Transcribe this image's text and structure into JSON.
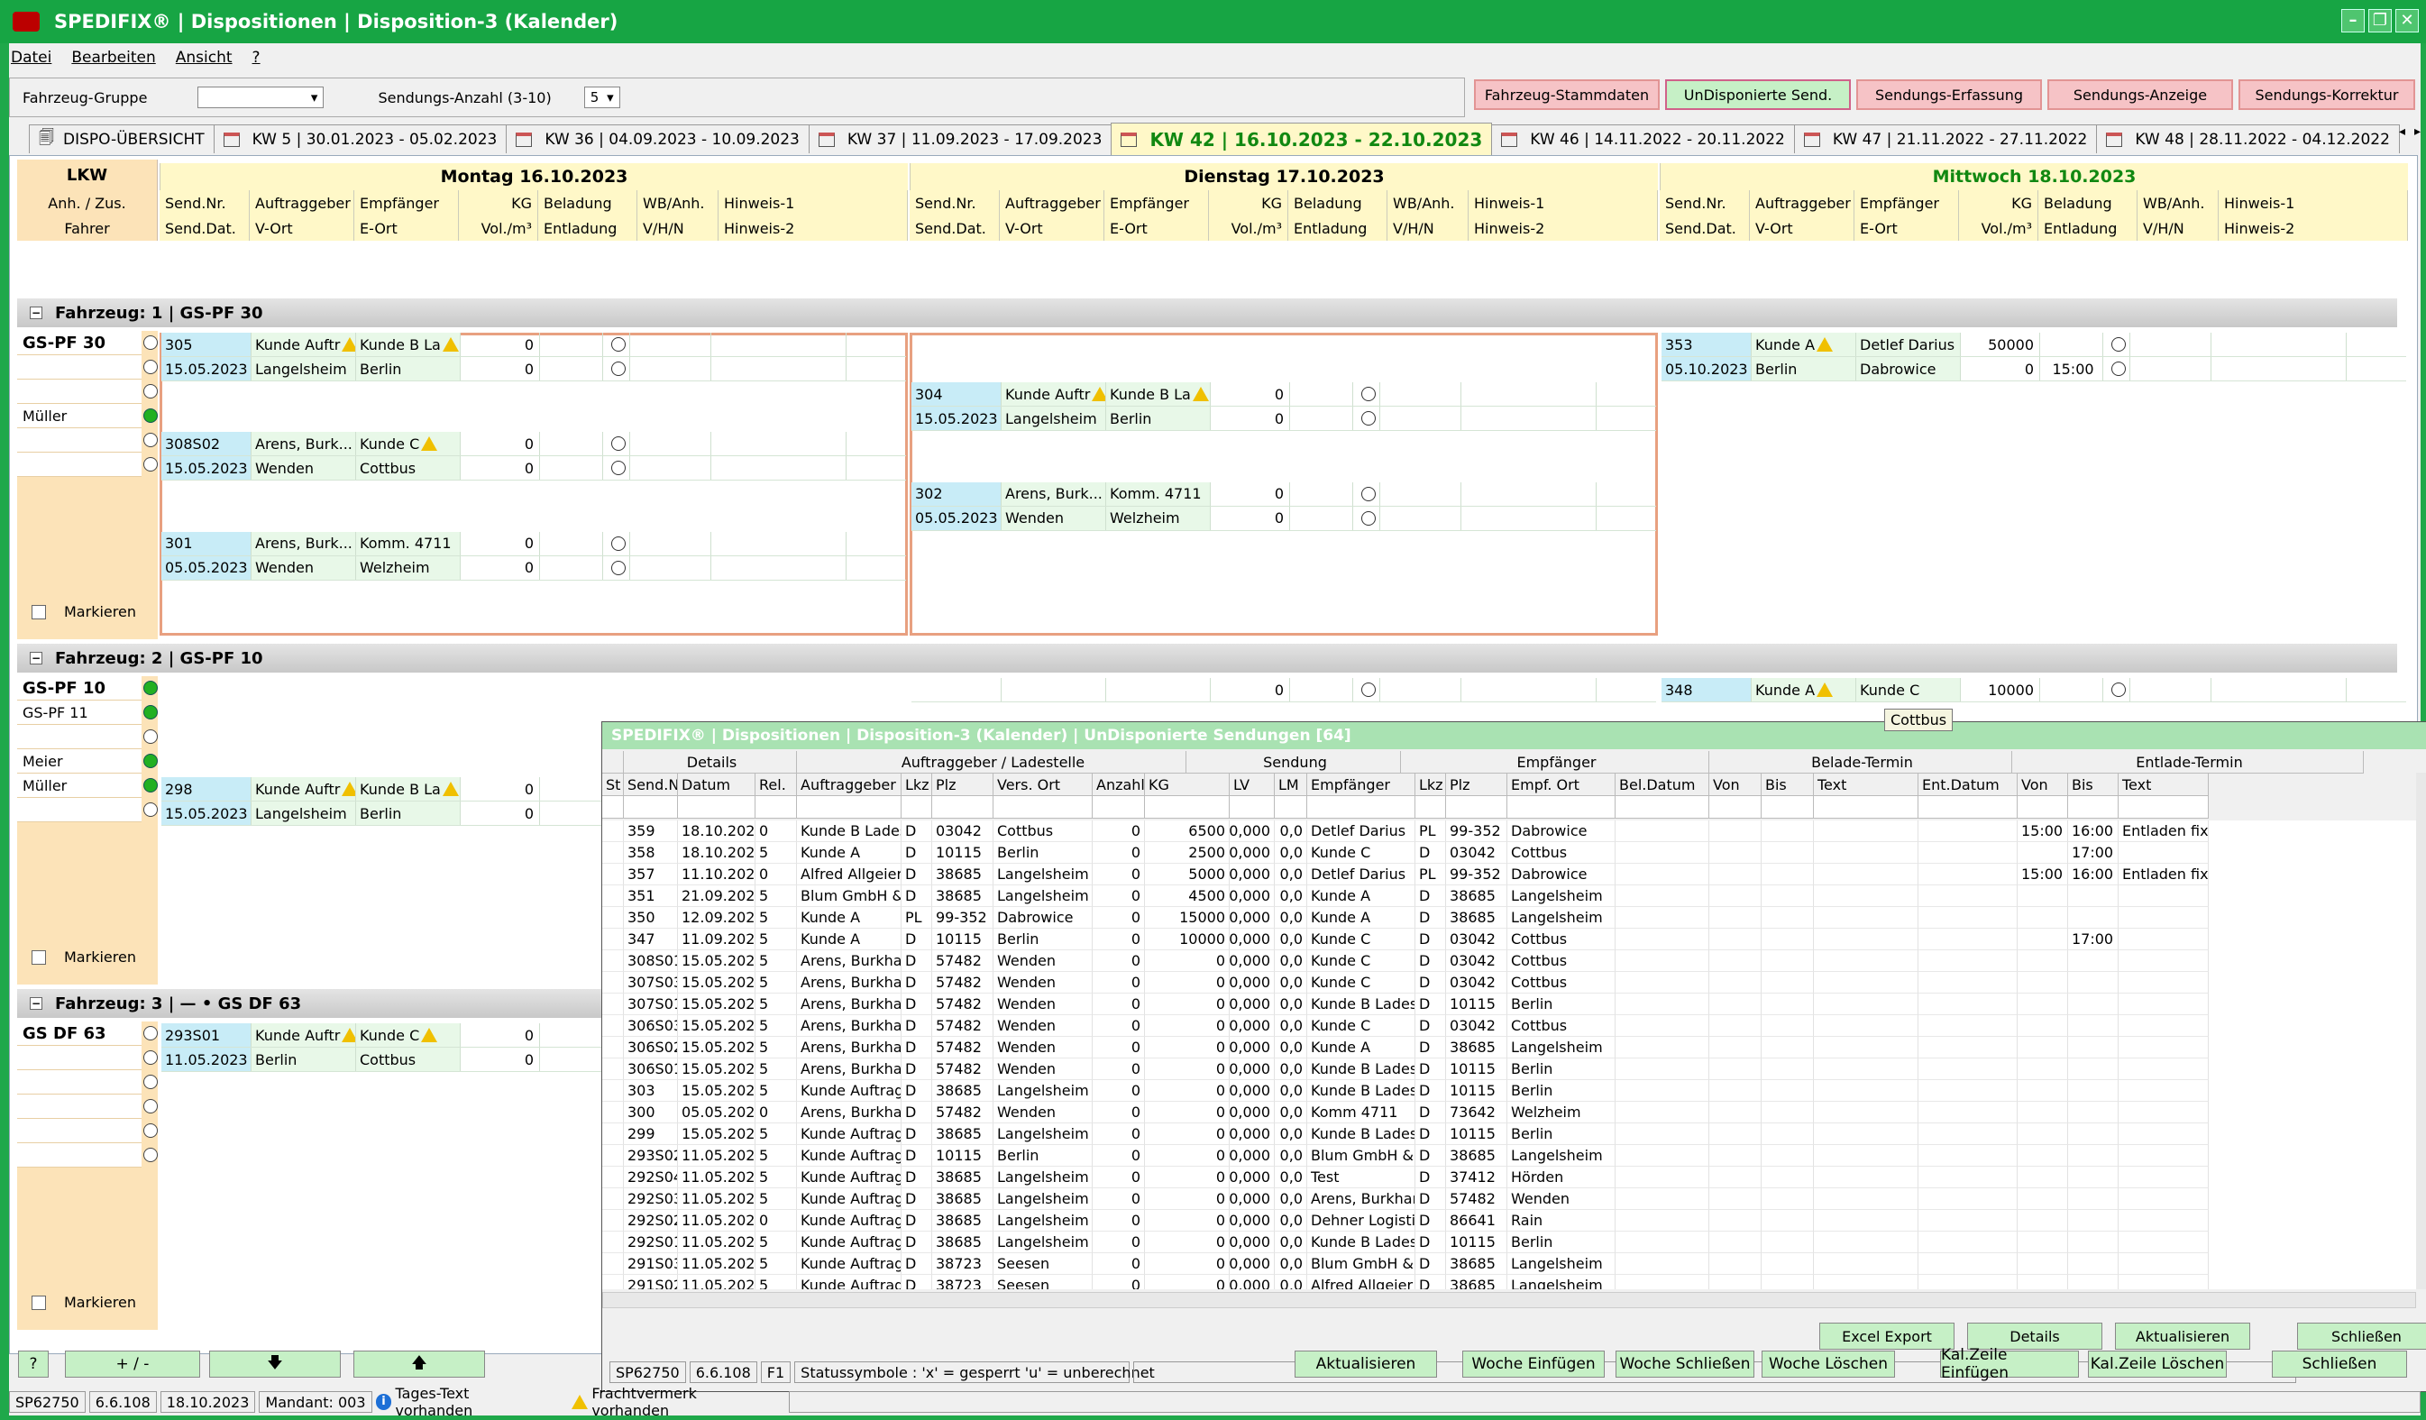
{
  "window": {
    "title": "SPEDIFIX® | Dispositionen | Disposition-3 (Kalender)"
  },
  "menu": [
    "Datei",
    "Bearbeiten",
    "Ansicht",
    "?"
  ],
  "filter": {
    "group_label": "Fahrzeug-Gruppe",
    "group_value": "",
    "count_label": "Sendungs-Anzahl (3-10)",
    "count_value": "5"
  },
  "topbuttons": [
    "Fahrzeug-Stammdaten",
    "UnDisponierte Send.",
    "Sendungs-Erfassung",
    "Sendungs-Anzeige",
    "Sendungs-Korrektur"
  ],
  "tabs": [
    "DISPO-ÜBERSICHT",
    "KW 5  |  30.01.2023 - 05.02.2023",
    "KW 36  |  04.09.2023 - 10.09.2023",
    "KW 37  |  11.09.2023 - 17.09.2023",
    "KW 42  |  16.10.2023 - 22.10.2023",
    "KW 46  |  14.11.2022 - 20.11.2022",
    "KW 47  |  21.11.2022 - 27.11.2022",
    "KW 48  |  28.11.2022 - 04.12.2022"
  ],
  "headers": {
    "lkw": "LKW",
    "anh": "Anh. / Zus.",
    "fahrer": "Fahrer",
    "row1": [
      "Send.Nr.",
      "Auftraggeber",
      "Empfänger",
      "KG",
      "Beladung",
      "WB/Anh.",
      "Hinweis-1"
    ],
    "row2": [
      "Send.Dat.",
      "V-Ort",
      "E-Ort",
      "Vol./m³",
      "Entladung",
      "V/H/N",
      "Hinweis-2"
    ]
  },
  "days": [
    "Montag 16.10.2023",
    "Dienstag 17.10.2023",
    "Mittwoch 18.10.2023"
  ],
  "labels": {
    "markieren": "Markieren"
  },
  "vehicles": [
    {
      "label": "Fahrzeug: 1 | GS-PF 30",
      "cells": [
        "GS-PF 30",
        "",
        "",
        "Müller",
        "",
        ""
      ],
      "dots": [
        "",
        "",
        "",
        "g",
        "",
        ""
      ]
    },
    {
      "label": "Fahrzeug: 2 | GS-PF 10",
      "cells": [
        "GS-PF 10",
        "GS-PF 11",
        "",
        "Meier",
        "Müller",
        ""
      ],
      "dots": [
        "g",
        "g",
        "",
        "g",
        "g",
        ""
      ]
    },
    {
      "label": "Fahrzeug: 3 | — • GS DF 63",
      "cells": [
        "GS DF 63",
        "",
        "",
        "",
        "",
        ""
      ],
      "dots": [
        "",
        "",
        "",
        "",
        "",
        ""
      ]
    }
  ],
  "cards": [
    {
      "day": 0,
      "row": 0,
      "v": 0,
      "r1": [
        "305",
        "Kunde Auftr",
        "Kunde B La",
        "0"
      ],
      "r2": [
        "15.05.2023",
        "Langelsheim",
        "Berlin",
        "0"
      ],
      "w1": true,
      "w2": true
    },
    {
      "day": 0,
      "row": 4,
      "v": 0,
      "r1": [
        "308S02",
        "Arens, Burk...",
        "Kunde C",
        "0"
      ],
      "r2": [
        "15.05.2023",
        "Wenden",
        "Cottbus",
        "0"
      ],
      "w2": true
    },
    {
      "day": 0,
      "row": 8,
      "v": 0,
      "r1": [
        "301",
        "Arens, Burk...",
        "Komm. 4711",
        "0"
      ],
      "r2": [
        "05.05.2023",
        "Wenden",
        "Welzheim",
        "0"
      ]
    },
    {
      "day": 1,
      "row": 2,
      "v": 0,
      "r1": [
        "304",
        "Kunde Auftr",
        "Kunde B La",
        "0"
      ],
      "r2": [
        "15.05.2023",
        "Langelsheim",
        "Berlin",
        "0"
      ],
      "w1": true,
      "w2": true
    },
    {
      "day": 1,
      "row": 6,
      "v": 0,
      "r1": [
        "302",
        "Arens, Burk...",
        "Komm. 4711",
        "0"
      ],
      "r2": [
        "05.05.2023",
        "Wenden",
        "Welzheim",
        "0"
      ]
    },
    {
      "day": 2,
      "row": 0,
      "v": 0,
      "r1": [
        "353",
        "Kunde A",
        "Detlef Darius",
        "50000"
      ],
      "r2": [
        "05.10.2023",
        "Berlin",
        "Dabrowice",
        "0"
      ],
      "w1": true,
      "t2": "15:00"
    },
    {
      "day": 0,
      "row": 4,
      "v": 1,
      "r1": [
        "298",
        "Kunde Auftr",
        "Kunde B La",
        "0"
      ],
      "r2": [
        "15.05.2023",
        "Langelsheim",
        "Berlin",
        "0"
      ],
      "w1": true,
      "w2": true
    },
    {
      "day": 1,
      "row": 0,
      "v": 1,
      "r1": [
        "",
        "",
        "",
        "0"
      ],
      "r2": null
    },
    {
      "day": 2,
      "row": 0,
      "v": 1,
      "r1": [
        "348",
        "Kunde A",
        "Kunde C",
        "10000"
      ],
      "r2": null,
      "w1": true
    },
    {
      "day": 0,
      "row": 0,
      "v": 2,
      "r1": [
        "293S01",
        "Kunde Auftr",
        "Kunde C",
        "0"
      ],
      "r2": [
        "11.05.2023",
        "Berlin",
        "Cottbus",
        "0"
      ],
      "w1": true,
      "w2": true
    }
  ],
  "popup": {
    "title": "SPEDIFIX® | Dispositionen | Disposition-3 (Kalender) | UnDisponierte Sendungen [64]",
    "groups": [
      "",
      "Details",
      "Auftraggeber / Ladestelle",
      "Sendung",
      "Empfänger",
      "Belade-Termin",
      "Entlade-Termin"
    ],
    "columns": [
      "St",
      "Send.Nr.",
      "Datum",
      "Rel.",
      "Auftraggeber",
      "Lkz",
      "Plz",
      "Vers. Ort",
      "Anzahl",
      "KG",
      "LV",
      "LM",
      "Empfänger",
      "Lkz",
      "Plz",
      "Empf. Ort",
      "Bel.Datum",
      "Von",
      "Bis",
      "Text",
      "Ent.Datum",
      "Von",
      "Bis",
      "Text"
    ],
    "rows": [
      [
        "",
        "359",
        "18.10.2023",
        "0",
        "Kunde B Lades",
        "D",
        "03042",
        "Cottbus",
        "0",
        "6500",
        "0,000",
        "0,0",
        "Detlef Darius",
        "PL",
        "99-352",
        "Dabrowice",
        "",
        "",
        "",
        "",
        "",
        "15:00",
        "16:00",
        "Entladen fix"
      ],
      [
        "",
        "358",
        "18.10.2023",
        "5",
        "Kunde A",
        "D",
        "10115",
        "Berlin",
        "0",
        "2500",
        "0,000",
        "0,0",
        "Kunde C",
        "D",
        "03042",
        "Cottbus",
        "",
        "",
        "",
        "",
        "",
        "",
        "17:00",
        ""
      ],
      [
        "",
        "357",
        "11.10.2023",
        "0",
        "Alfred Allgeier",
        "D",
        "38685",
        "Langelsheim",
        "0",
        "5000",
        "0,000",
        "0,0",
        "Detlef Darius",
        "PL",
        "99-352",
        "Dabrowice",
        "",
        "",
        "",
        "",
        "",
        "15:00",
        "16:00",
        "Entladen fix"
      ],
      [
        "",
        "351",
        "21.09.2023",
        "5",
        "Blum GmbH & C",
        "D",
        "38685",
        "Langelsheim",
        "0",
        "4500",
        "0,000",
        "0,0",
        "Kunde A",
        "D",
        "38685",
        "Langelsheim",
        "",
        "",
        "",
        "",
        "",
        "",
        "",
        ""
      ],
      [
        "",
        "350",
        "12.09.2023",
        "5",
        "Kunde A",
        "PL",
        "99-352",
        "Dabrowice",
        "0",
        "15000",
        "0,000",
        "0,0",
        "Kunde A",
        "D",
        "38685",
        "Langelsheim",
        "",
        "",
        "",
        "",
        "",
        "",
        "",
        ""
      ],
      [
        "",
        "347",
        "11.09.2023",
        "5",
        "Kunde A",
        "D",
        "10115",
        "Berlin",
        "0",
        "10000",
        "0,000",
        "0,0",
        "Kunde C",
        "D",
        "03042",
        "Cottbus",
        "",
        "",
        "",
        "",
        "",
        "",
        "17:00",
        ""
      ],
      [
        "",
        "308S01",
        "15.05.2023",
        "5",
        "Arens, Burkhar",
        "D",
        "57482",
        "Wenden",
        "0",
        "0",
        "0,000",
        "0,0",
        "Kunde C",
        "D",
        "03042",
        "Cottbus",
        "",
        "",
        "",
        "",
        "",
        "",
        "",
        ""
      ],
      [
        "",
        "307S03",
        "15.05.2023",
        "5",
        "Arens, Burkhar",
        "D",
        "57482",
        "Wenden",
        "0",
        "0",
        "0,000",
        "0,0",
        "Kunde C",
        "D",
        "03042",
        "Cottbus",
        "",
        "",
        "",
        "",
        "",
        "",
        "",
        ""
      ],
      [
        "",
        "307S01",
        "15.05.2023",
        "5",
        "Arens, Burkhar",
        "D",
        "57482",
        "Wenden",
        "0",
        "0",
        "0,000",
        "0,0",
        "Kunde B Lades",
        "D",
        "10115",
        "Berlin",
        "",
        "",
        "",
        "",
        "",
        "",
        "",
        ""
      ],
      [
        "",
        "306S03",
        "15.05.2023",
        "5",
        "Arens, Burkhar",
        "D",
        "57482",
        "Wenden",
        "0",
        "0",
        "0,000",
        "0,0",
        "Kunde C",
        "D",
        "03042",
        "Cottbus",
        "",
        "",
        "",
        "",
        "",
        "",
        "",
        ""
      ],
      [
        "",
        "306S02",
        "15.05.2023",
        "5",
        "Arens, Burkhar",
        "D",
        "57482",
        "Wenden",
        "0",
        "0",
        "0,000",
        "0,0",
        "Kunde A",
        "D",
        "38685",
        "Langelsheim",
        "",
        "",
        "",
        "",
        "",
        "",
        "",
        ""
      ],
      [
        "",
        "306S01",
        "15.05.2023",
        "5",
        "Arens, Burkhar",
        "D",
        "57482",
        "Wenden",
        "0",
        "0",
        "0,000",
        "0,0",
        "Kunde B Lades",
        "D",
        "10115",
        "Berlin",
        "",
        "",
        "",
        "",
        "",
        "",
        "",
        ""
      ],
      [
        "",
        "303",
        "15.05.2023",
        "5",
        "Kunde Auftragg",
        "D",
        "38685",
        "Langelsheim",
        "0",
        "0",
        "0,000",
        "0,0",
        "Kunde B Lades",
        "D",
        "10115",
        "Berlin",
        "",
        "",
        "",
        "",
        "",
        "",
        "",
        ""
      ],
      [
        "",
        "300",
        "05.05.2023",
        "0",
        "Arens, Burkhar",
        "D",
        "57482",
        "Wenden",
        "0",
        "0",
        "0,000",
        "0,0",
        "Komm 4711",
        "D",
        "73642",
        "Welzheim",
        "",
        "",
        "",
        "",
        "",
        "",
        "",
        ""
      ],
      [
        "",
        "299",
        "15.05.2023",
        "5",
        "Kunde Auftragg",
        "D",
        "38685",
        "Langelsheim",
        "0",
        "0",
        "0,000",
        "0,0",
        "Kunde B Lades",
        "D",
        "10115",
        "Berlin",
        "",
        "",
        "",
        "",
        "",
        "",
        "",
        ""
      ],
      [
        "",
        "293S02",
        "11.05.2023",
        "5",
        "Kunde Auftragg",
        "D",
        "10115",
        "Berlin",
        "0",
        "0",
        "0,000",
        "0,0",
        "Blum GmbH & C",
        "D",
        "38685",
        "Langelsheim",
        "",
        "",
        "",
        "",
        "",
        "",
        "",
        ""
      ],
      [
        "",
        "292S04",
        "11.05.2023",
        "5",
        "Kunde Auftragg",
        "D",
        "38685",
        "Langelsheim",
        "0",
        "0",
        "0,000",
        "0,0",
        "Test",
        "D",
        "37412",
        "Hörden",
        "",
        "",
        "",
        "",
        "",
        "",
        "",
        ""
      ],
      [
        "",
        "292S03",
        "11.05.2023",
        "5",
        "Kunde Auftragg",
        "D",
        "38685",
        "Langelsheim",
        "0",
        "0",
        "0,000",
        "0,0",
        "Arens, Burkhar",
        "D",
        "57482",
        "Wenden",
        "",
        "",
        "",
        "",
        "",
        "",
        "",
        ""
      ],
      [
        "",
        "292S02",
        "11.05.2023",
        "0",
        "Kunde Auftragg",
        "D",
        "38685",
        "Langelsheim",
        "0",
        "0",
        "0,000",
        "0,0",
        "Dehner Logistik",
        "D",
        "86641",
        "Rain",
        "",
        "",
        "",
        "",
        "",
        "",
        "",
        ""
      ],
      [
        "",
        "292S01",
        "11.05.2023",
        "5",
        "Kunde Auftragg",
        "D",
        "38685",
        "Langelsheim",
        "0",
        "0",
        "0,000",
        "0,0",
        "Kunde B Lades",
        "D",
        "10115",
        "Berlin",
        "",
        "",
        "",
        "",
        "",
        "",
        "",
        ""
      ],
      [
        "",
        "291S03",
        "11.05.2023",
        "5",
        "Kunde Auftragg",
        "D",
        "38723",
        "Seesen",
        "0",
        "0",
        "0,000",
        "0,0",
        "Blum GmbH & C",
        "D",
        "38685",
        "Langelsheim",
        "",
        "",
        "",
        "",
        "",
        "",
        "",
        ""
      ],
      [
        "",
        "291S02",
        "11.05.2023",
        "5",
        "Kunde Auftragg",
        "D",
        "38723",
        "Seesen",
        "0",
        "0",
        "0,000",
        "0,0",
        "Alfred Allgeier",
        "D",
        "38685",
        "Langelsheim",
        "",
        "",
        "",
        "",
        "",
        "",
        "",
        ""
      ]
    ],
    "buttons": [
      "Excel Export",
      "Details",
      "Aktualisieren",
      "Schließen"
    ],
    "status": [
      "SP62750",
      "6.6.108",
      "F1",
      "Statussymbole :  'x' = gesperrt   'u' = unberechnet"
    ]
  },
  "tooltip": "Cottbus",
  "bottom": {
    "help": "?",
    "plusminus": "+ / -",
    "buttons": [
      "Aktualisieren",
      "Woche Einfügen",
      "Woche Schließen",
      "Woche Löschen",
      "Kal.Zeile Einfügen",
      "Kal.Zeile Löschen",
      "Schließen"
    ]
  },
  "status": [
    "SP62750",
    "6.6.108",
    "18.10.2023",
    "Mandant: 003",
    "Tages-Text vorhanden",
    "Frachtvermerk vorhanden"
  ]
}
